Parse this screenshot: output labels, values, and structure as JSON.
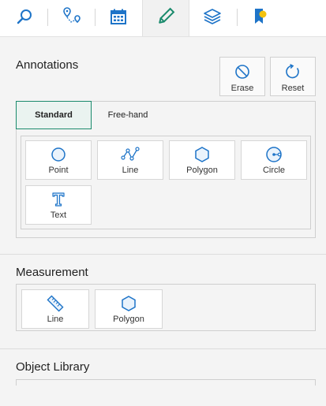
{
  "toolbar": {
    "items": [
      {
        "name": "search-icon"
      },
      {
        "name": "route-icon"
      },
      {
        "name": "calendar-icon"
      },
      {
        "name": "pencil-icon",
        "active": true
      },
      {
        "name": "layers-icon"
      },
      {
        "name": "bookmark-icon"
      }
    ]
  },
  "annotations": {
    "title": "Annotations",
    "erase_label": "Erase",
    "reset_label": "Reset",
    "tabs": [
      "Standard",
      "Free-hand"
    ],
    "tools": [
      {
        "label": "Point",
        "icon": "point-icon"
      },
      {
        "label": "Line",
        "icon": "line-icon"
      },
      {
        "label": "Polygon",
        "icon": "polygon-icon"
      },
      {
        "label": "Circle",
        "icon": "circle-icon"
      },
      {
        "label": "Text",
        "icon": "text-icon"
      }
    ]
  },
  "measurement": {
    "title": "Measurement",
    "tools": [
      {
        "label": "Line",
        "icon": "ruler-icon"
      },
      {
        "label": "Polygon",
        "icon": "polygon-icon"
      }
    ]
  },
  "object_library": {
    "title": "Object Library"
  },
  "colors": {
    "accent": "#1a8a6c",
    "icon_blue": "#1e74c8",
    "bookmark_yellow": "#f4c20d"
  }
}
